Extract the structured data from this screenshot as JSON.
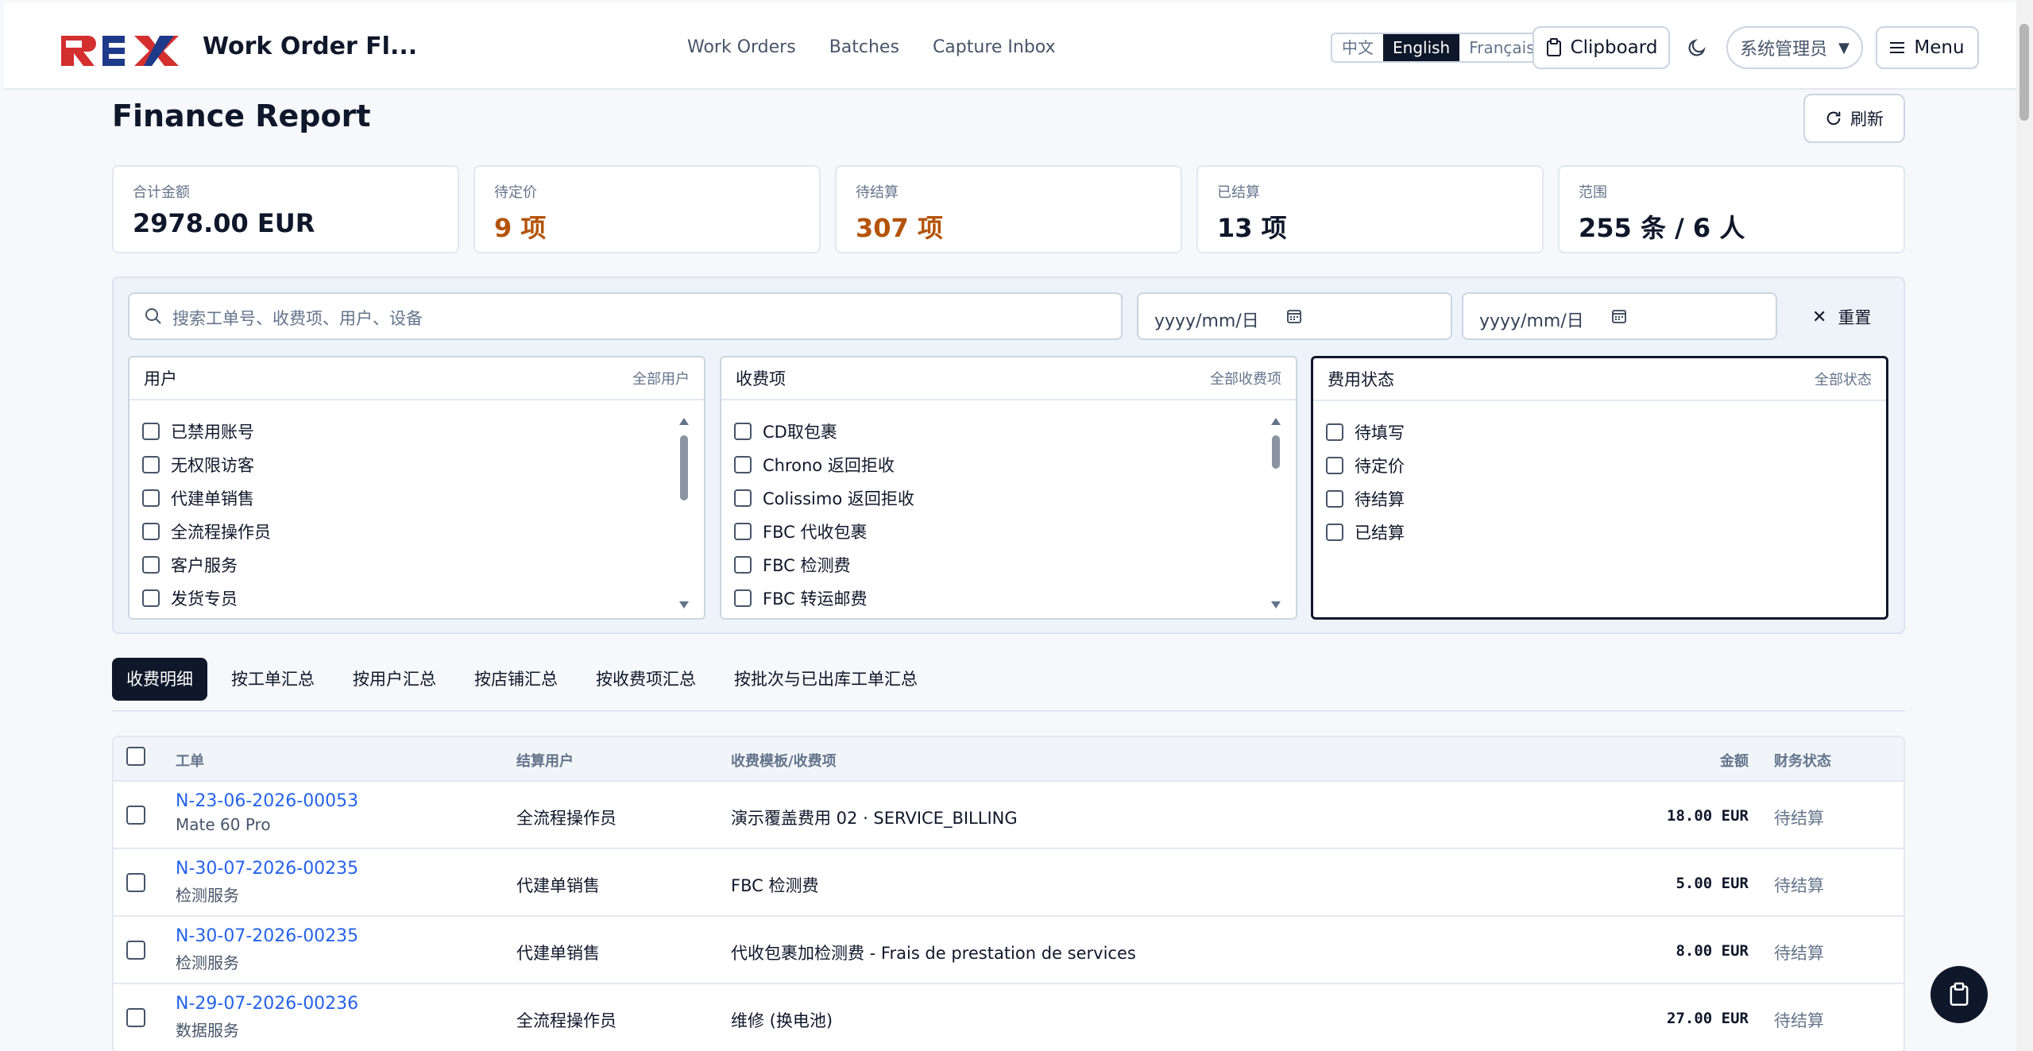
{
  "header": {
    "logo_alt": "REX",
    "app_title": "Work Order Fl...",
    "nav": [
      "Work Orders",
      "Batches",
      "Capture Inbox"
    ],
    "languages": [
      {
        "label": "中文",
        "active": false
      },
      {
        "label": "English",
        "active": true
      },
      {
        "label": "Français",
        "active": false
      }
    ],
    "clipboard_label": "Clipboard",
    "user_select": "系统管理员",
    "menu_label": "Menu"
  },
  "page": {
    "title": "Finance Report",
    "refresh_label": "刷新"
  },
  "stats": [
    {
      "label": "合计金额",
      "value": "2978.00 EUR",
      "warn": false
    },
    {
      "label": "待定价",
      "value": "9 项",
      "warn": true
    },
    {
      "label": "待结算",
      "value": "307 项",
      "warn": true
    },
    {
      "label": "已结算",
      "value": "13 项",
      "warn": false
    },
    {
      "label": "范围",
      "value": "255 条 / 6 人",
      "warn": false
    }
  ],
  "filters": {
    "search_placeholder": "搜索工单号、收费项、用户、设备",
    "date_from_placeholder": "yyyy/mm/日",
    "date_to_placeholder": "yyyy/mm/日",
    "reset_label": "重置",
    "panels": [
      {
        "title": "用户",
        "all_label": "全部用户",
        "options": [
          "已禁用账号",
          "无权限访客",
          "代建单销售",
          "全流程操作员",
          "客户服务",
          "发货专员"
        ]
      },
      {
        "title": "收费项",
        "all_label": "全部收费项",
        "options": [
          "CD取包裹",
          "Chrono 返回拒收",
          "Colissimo 返回拒收",
          "FBC 代收包裹",
          "FBC 检测费",
          "FBC 转运邮费"
        ]
      },
      {
        "title": "费用状态",
        "all_label": "全部状态",
        "options": [
          "待填写",
          "待定价",
          "待结算",
          "已结算"
        ]
      }
    ]
  },
  "tabs": [
    {
      "label": "收费明细",
      "active": true
    },
    {
      "label": "按工单汇总",
      "active": false
    },
    {
      "label": "按用户汇总",
      "active": false
    },
    {
      "label": "按店铺汇总",
      "active": false
    },
    {
      "label": "按收费项汇总",
      "active": false
    },
    {
      "label": "按批次与已出库工单汇总",
      "active": false
    }
  ],
  "table": {
    "headers": {
      "work_order": "工单",
      "user": "结算用户",
      "item": "收费模板/收费项",
      "amount": "金额",
      "status": "财务状态"
    },
    "rows": [
      {
        "work_order": "N-23-06-2026-00053",
        "device": "Mate 60 Pro",
        "user": "全流程操作员",
        "item": "演示覆盖费用 02 · SERVICE_BILLING",
        "amount": "18.00 EUR",
        "status": "待结算"
      },
      {
        "work_order": "N-30-07-2026-00235",
        "device": "检测服务",
        "user": "代建单销售",
        "item": "FBC 检测费",
        "amount": "5.00 EUR",
        "status": "待结算"
      },
      {
        "work_order": "N-30-07-2026-00235",
        "device": "检测服务",
        "user": "代建单销售",
        "item": "代收包裹加检测费 - Frais de prestation de services",
        "amount": "8.00 EUR",
        "status": "待结算"
      },
      {
        "work_order": "N-29-07-2026-00236",
        "device": "数据服务",
        "user": "全流程操作员",
        "item": "维修 (换电池)",
        "amount": "27.00 EUR",
        "status": "待结算"
      }
    ]
  },
  "colors": {
    "primary": "#0f172a",
    "accent_link": "#2563eb",
    "warn": "#b45309",
    "logo_red": "#d32f2f",
    "logo_blue": "#1e3a8a"
  }
}
